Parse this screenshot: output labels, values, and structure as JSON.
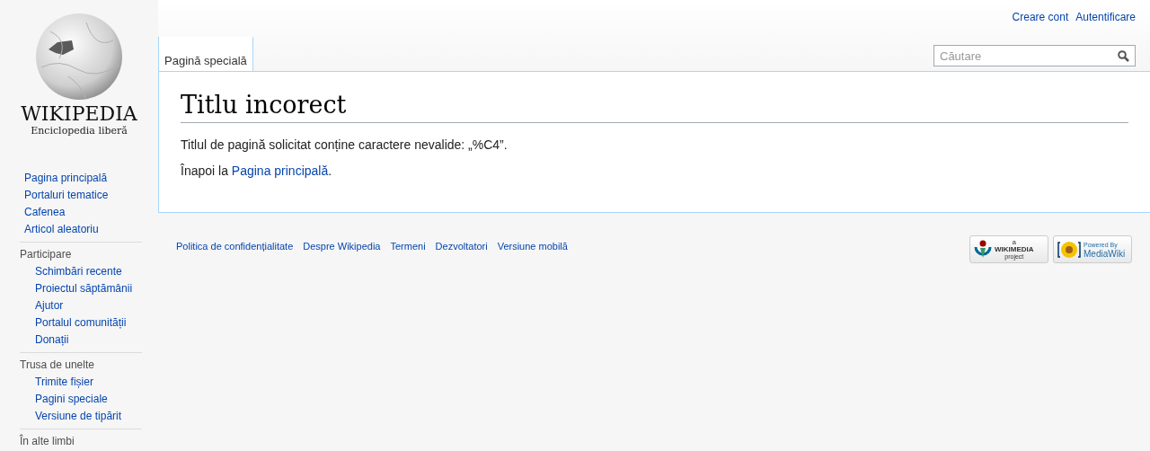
{
  "logo": {
    "wordmark": "WIKIPEDIA",
    "tagline": "Enciclopedia liberă"
  },
  "personal_links": [
    "Creare cont",
    "Autentificare"
  ],
  "tabs": [
    {
      "label": "Pagină specială",
      "selected": true
    }
  ],
  "search": {
    "placeholder": "Căutare"
  },
  "sidebar": {
    "items": [
      {
        "label": "Pagina principală"
      },
      {
        "label": "Portaluri tematice"
      },
      {
        "label": "Cafenea"
      },
      {
        "label": "Articol aleatoriu"
      }
    ],
    "sections": [
      {
        "heading": "Participare",
        "items": [
          "Schimbări recente",
          "Proiectul săptămânii",
          "Ajutor",
          "Portalul comunității",
          "Donații"
        ]
      },
      {
        "heading": "Trusa de unelte",
        "items": [
          "Trimite fișier",
          "Pagini speciale",
          "Versiune de tipărit"
        ]
      },
      {
        "heading": "În alte limbi"
      }
    ]
  },
  "content": {
    "title": "Titlu incorect",
    "message": "Titlul de pagină solicitat conține caractere nevalide: „%C4”.",
    "back_prefix": "Înapoi la ",
    "back_link": "Pagina principală",
    "back_suffix": "."
  },
  "footer": {
    "links": [
      "Politica de confidențialitate",
      "Despre Wikipedia",
      "Termeni",
      "Dezvoltatori",
      "Versiune mobilă"
    ],
    "badges": [
      {
        "kind": "wikimedia",
        "small": "a",
        "main": "WIKIMEDIA",
        "sub": "project"
      },
      {
        "kind": "mediawiki",
        "small": "Powered By",
        "main": "MediaWiki"
      }
    ]
  }
}
